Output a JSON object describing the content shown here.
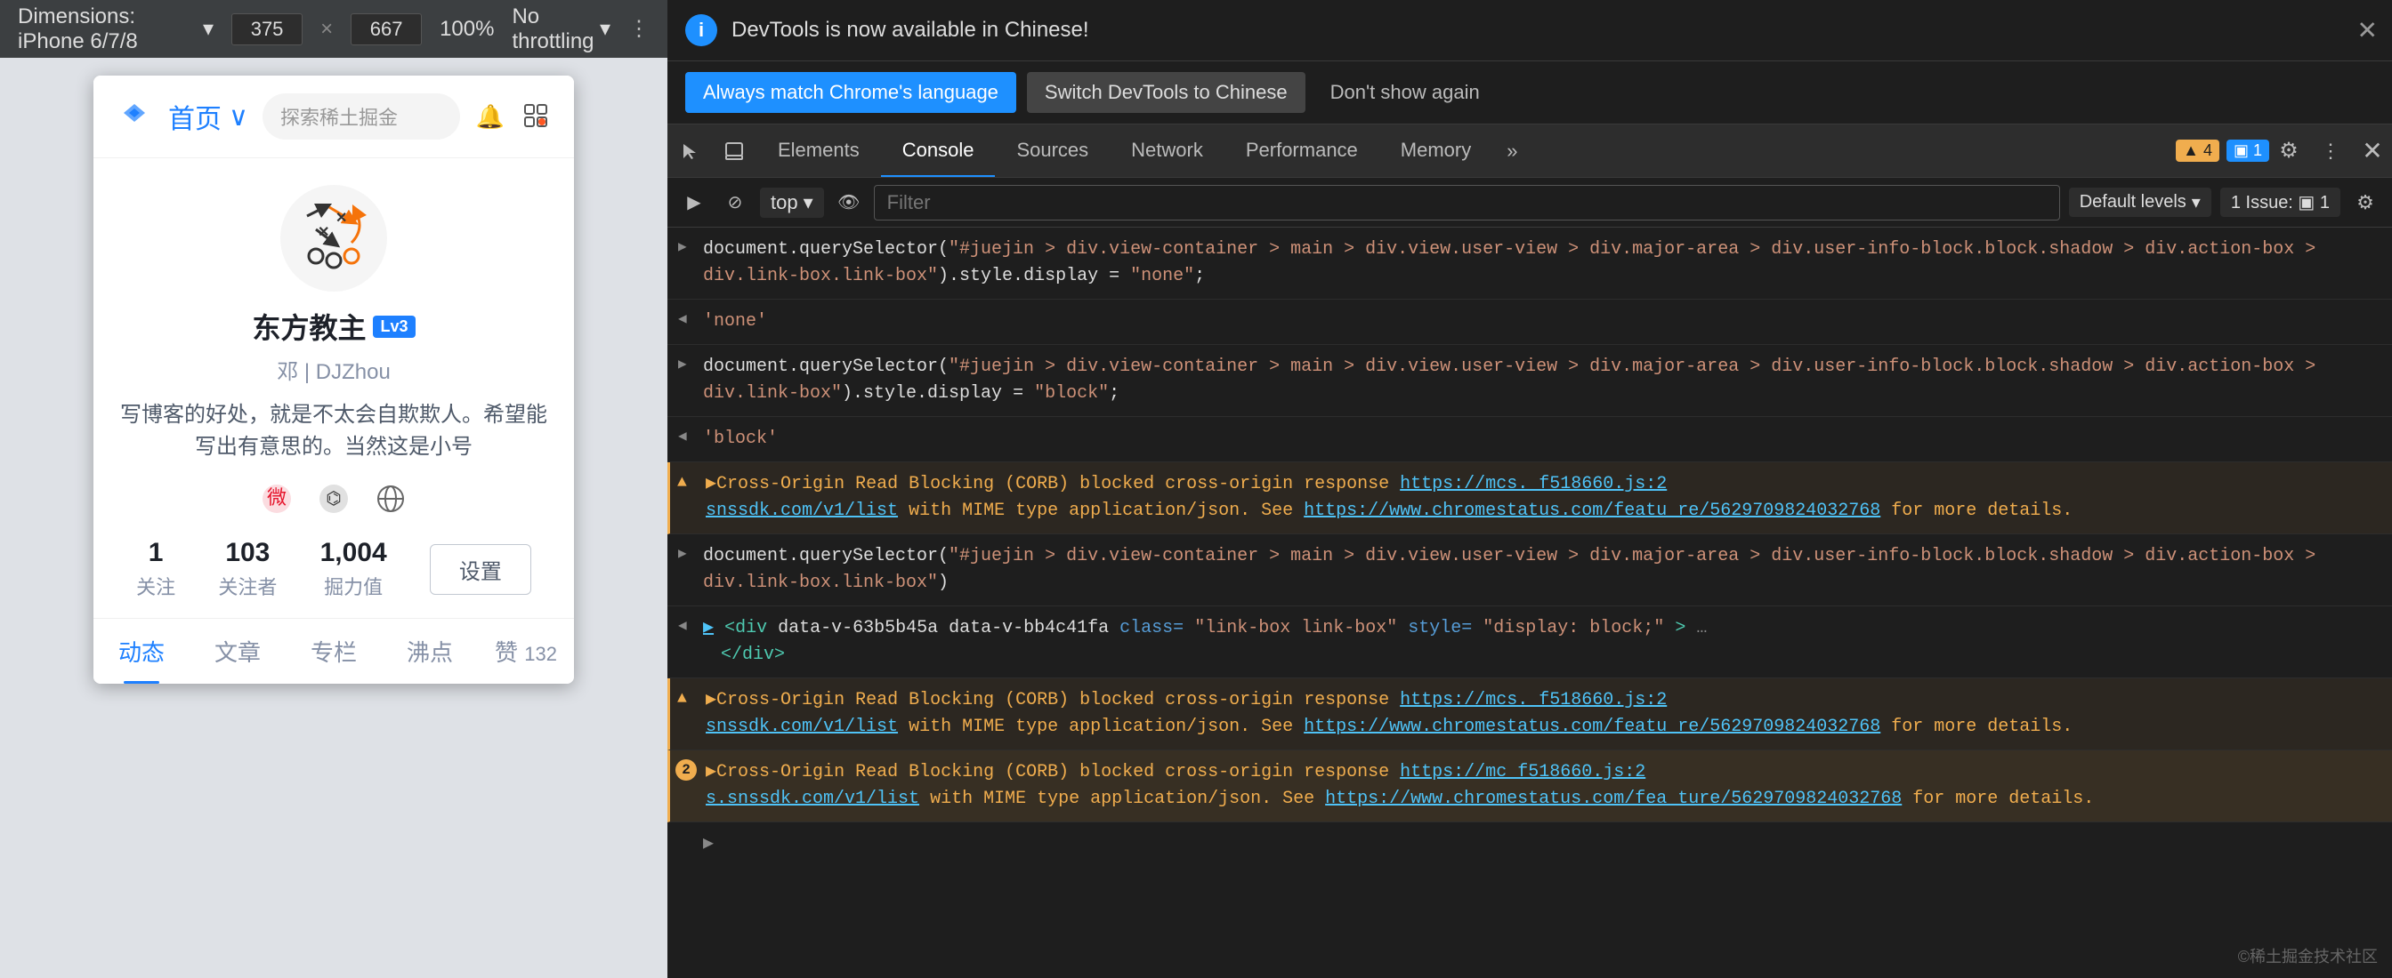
{
  "deviceToolbar": {
    "deviceName": "Dimensions: iPhone 6/7/8",
    "width": "375",
    "height": "667",
    "zoom": "100%",
    "throttle": "No throttling",
    "moreIcon": "⋮"
  },
  "mobileApp": {
    "header": {
      "homeLabel": "首页",
      "chevron": "∨",
      "searchPlaceholder": "探索稀土掘金"
    },
    "profile": {
      "userName": "东方教主",
      "levelBadge": "Lv3",
      "userId": "邓 | DJZhou",
      "bio": "写博客的好处，就是不太会自欺欺人。希望能写出有意思的。当然这是小号",
      "followingCount": "1",
      "followingLabel": "关注",
      "followersCount": "103",
      "followersLabel": "关注者",
      "juejinScore": "1,004",
      "juejinLabel": "掘力值",
      "settingsLabel": "设置"
    },
    "tabs": [
      {
        "label": "动态",
        "active": true
      },
      {
        "label": "文章",
        "active": false
      },
      {
        "label": "专栏",
        "active": false
      },
      {
        "label": "沸点",
        "active": false
      },
      {
        "label": "赞",
        "badge": "132",
        "active": false
      }
    ]
  },
  "devtools": {
    "infoBar": {
      "message": "DevTools is now available in Chinese!",
      "closeIcon": "✕"
    },
    "langBar": {
      "primaryBtn": "Always match Chrome's language",
      "secondaryBtn": "Switch DevTools to Chinese",
      "ghostBtn": "Don't show again"
    },
    "tabs": [
      {
        "label": "Elements",
        "active": false
      },
      {
        "label": "Console",
        "active": true
      },
      {
        "label": "Sources",
        "active": false
      },
      {
        "label": "Network",
        "active": false
      },
      {
        "label": "Performance",
        "active": false
      },
      {
        "label": "Memory",
        "active": false
      }
    ],
    "badgeWarning": "▲ 4",
    "badgeInfo": "▣ 1",
    "consoleToolbar": {
      "filterPlaceholder": "Filter",
      "contextLabel": "top",
      "levelsLabel": "Default levels",
      "issuesLabel": "1 Issue: ▣ 1"
    },
    "consoleEntries": [
      {
        "type": "expression",
        "arrow": "▶",
        "content": "document.querySelector(\"#juejin > div.view-container > main > div.view.user-view > div.major-area > div.user-info-block.block.shadow > div.action-box > div.link-box.link-box\").style.display = \"none\";"
      },
      {
        "type": "result",
        "arrow": "◀",
        "content": "'none'"
      },
      {
        "type": "expression",
        "arrow": "▶",
        "content": "document.querySelector(\"#juejin > div.view-container > main > div.view.user-view > div.major-area > div.user-info-block.block.shadow > div.action-box > div.link-box\").style.display = \"block\";"
      },
      {
        "type": "result",
        "arrow": "◀",
        "content": "'block'"
      },
      {
        "type": "warning",
        "content": "▶Cross-Origin Read Blocking (CORB) blocked cross-origin response",
        "link1": "https://mcs. f518660.js:2",
        "mid1": "snssdk.com/v1/list",
        "link2": "https://www.chromestatus.com/featu re/5629709824032768",
        "suffix": "for more details."
      },
      {
        "type": "expression",
        "arrow": "▶",
        "content": "document.querySelector(\"#juejin > div.view-container > main > div.view.user-view > div.major-area > div.user-info-block.block.shadow > div.action-box > div.link-box.link-box\")"
      },
      {
        "type": "result-html",
        "arrow": "◀",
        "content": "▶ <div data-v-63b5b45a data-v-bb4c41fa class=\"link-box link-box\" style=\"display: block;\">…",
        "suffix": "</div>"
      },
      {
        "type": "warning",
        "content": "▶Cross-Origin Read Blocking (CORB) blocked cross-origin response",
        "link1": "https://mcs. f518660.js:2",
        "mid1": "snssdk.com/v1/list",
        "link2": "https://www.chromestatus.com/featu re/5629709824032768",
        "suffix": "for more details."
      },
      {
        "type": "warning-2",
        "num": "2",
        "content": "▶Cross-Origin Read Blocking (CORB) blocked cross-origin response",
        "link1": "https://mc f518660.js:2",
        "mid1": "s.snssdk.com/v1/list",
        "link2": "https://www.chromestatus.com/fea ture/5629709824032768",
        "suffix": "for more details."
      }
    ],
    "watermark": "©稀土掘金技术社区"
  }
}
